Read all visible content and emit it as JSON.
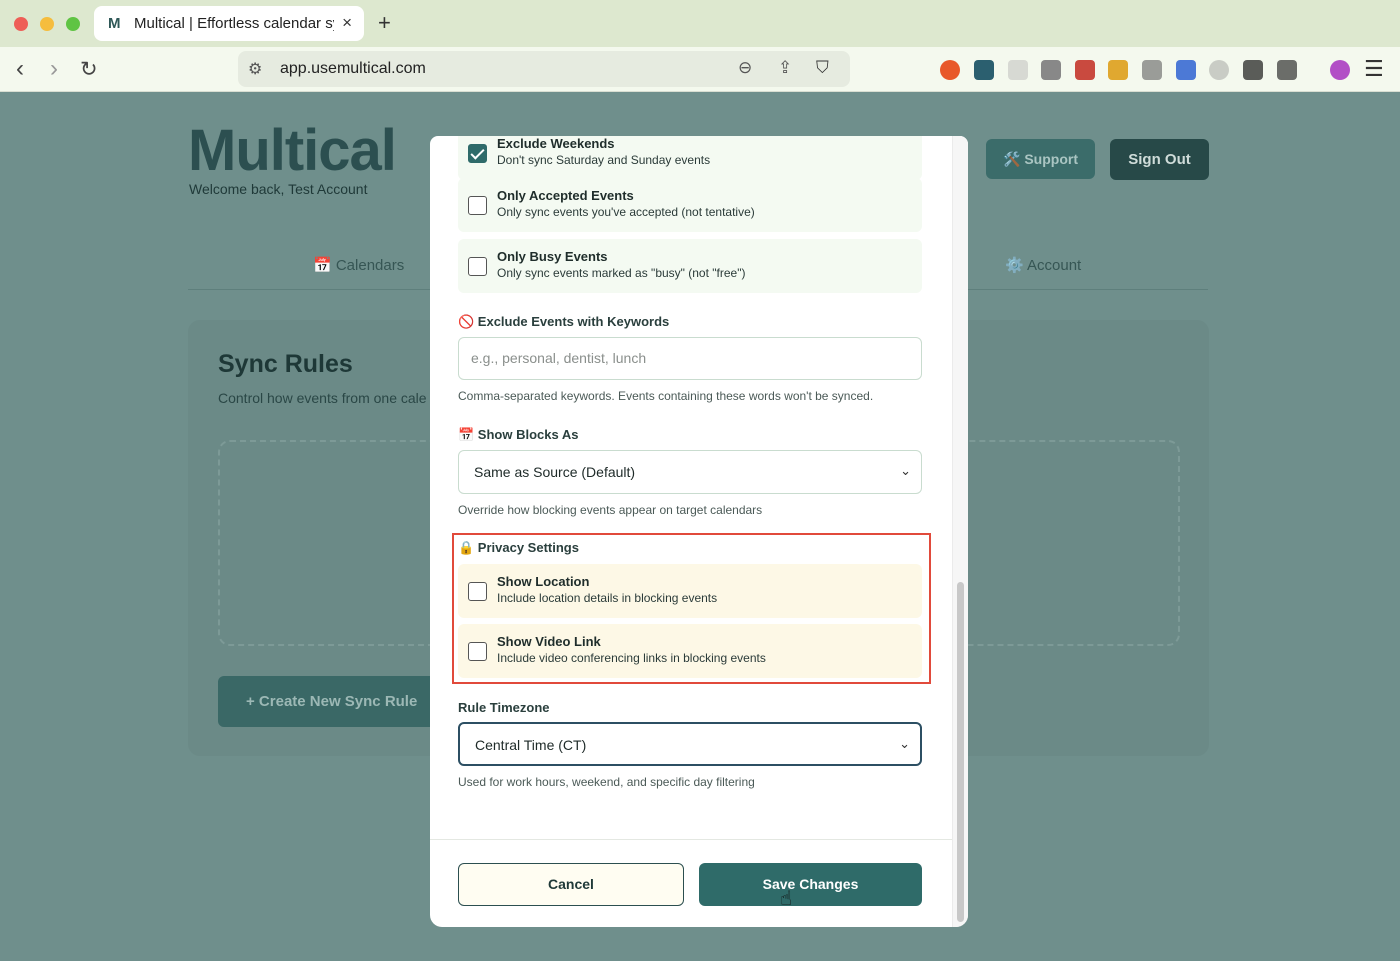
{
  "browser": {
    "tab_title": "Multical | Effortless calendar sy",
    "tab_logo": "M",
    "tab_close": "×",
    "new_tab": "+",
    "url": "app.usemultical.com"
  },
  "page": {
    "brand": "Multical",
    "welcome": "Welcome back, Test Account",
    "support_label": "🛠️ Support",
    "signout_label": "Sign Out",
    "tabs": {
      "calendars": "📅 Calendars",
      "account": "⚙️ Account"
    },
    "card_title": "Sync Rules",
    "card_subtitle": "Control how events from one cale",
    "create_label": "+   Create New Sync Rule"
  },
  "modal": {
    "options_top": [
      {
        "title": "Exclude Weekends",
        "desc": "Don't sync Saturday and Sunday events",
        "checked": true
      },
      {
        "title": "Only Accepted Events",
        "desc": "Only sync events you've accepted (not tentative)",
        "checked": false
      },
      {
        "title": "Only Busy Events",
        "desc": "Only sync events marked as \"busy\" (not \"free\")",
        "checked": false
      }
    ],
    "keywords_label": "🚫 Exclude Events with Keywords",
    "keywords_placeholder": "e.g., personal, dentist, lunch",
    "keywords_help": "Comma-separated keywords. Events containing these words won't be synced.",
    "blocks_label": "📅 Show Blocks As",
    "blocks_value": "Same as Source (Default)",
    "blocks_help": "Override how blocking events appear on target calendars",
    "privacy_label": "🔒 Privacy Settings",
    "privacy_options": [
      {
        "title": "Show Location",
        "desc": "Include location details in blocking events",
        "checked": false
      },
      {
        "title": "Show Video Link",
        "desc": "Include video conferencing links in blocking events",
        "checked": false
      }
    ],
    "timezone_label": "Rule Timezone",
    "timezone_value": "Central Time (CT)",
    "timezone_help": "Used for work hours, weekend, and specific day filtering",
    "cancel_label": "Cancel",
    "save_label": "Save Changes"
  },
  "colors": {
    "accent": "#2f6b69",
    "highlight": "#e14a3b",
    "privacy_bg": "#fdf8e6"
  }
}
